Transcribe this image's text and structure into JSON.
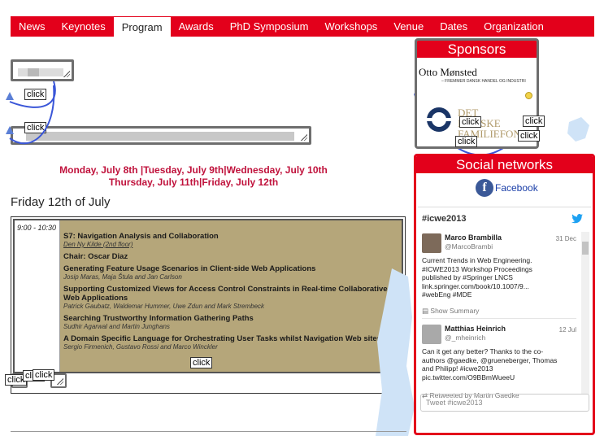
{
  "nav": {
    "items": [
      "News",
      "Keynotes",
      "Program",
      "Awards",
      "PhD Symposium",
      "Workshops",
      "Venue",
      "Dates",
      "Organization"
    ],
    "active": "Program"
  },
  "overlay": {
    "click_label": "click"
  },
  "days": {
    "line1": "Monday, July 8th |Tuesday, July 9th|Wednesday, July 10th",
    "line2": "Thursday, July 11th|Friday, July 12th"
  },
  "day_title": "Friday 12th of July",
  "schedule": {
    "time": "9:00 - 10:30",
    "sessions": [
      {
        "title": "S7: Navigation Analysis and Collaboration",
        "sub": "Den Ny Kilde (2nd floor)",
        "sub_link": true
      },
      {
        "title": "Chair: Oscar Diaz",
        "sub": ""
      },
      {
        "title": "Generating Feature Usage Scenarios in Client-side Web Applications",
        "sub": "Josip Maras, Maja Štula and Jan Carlson"
      },
      {
        "title": "Supporting Customized Views for Access Control Constraints in Real-time Collaborative Web Applications",
        "sub": "Patrick Gaubatz, Waldemar Hummer, Uwe Zdun and Mark Strembeck"
      },
      {
        "title": "Searching Trustworthy Information Gathering Paths",
        "sub": "Sudhir Agarwal and Martin Junghans"
      },
      {
        "title": "A Domain Specific Language for Orchestrating User Tasks whilst Navigation Web sites",
        "sub": "Sergio Firmenich, Gustavo Rossi and Marco Winckler"
      }
    ]
  },
  "sponsors": {
    "title": "Sponsors",
    "otto": "Otto Mønsted",
    "otto_sub": "– FREMMER DANSK HANDEL OG INDUSTRI",
    "det_line1": "DET",
    "det_line2": "DANSKE",
    "det_line3": "FAMILIEFOND"
  },
  "social": {
    "title": "Social networks",
    "facebook_label": "Facebook",
    "hashtag": "#icwe2013",
    "tweets": [
      {
        "name": "Marco Brambilla",
        "handle": "@MarcoBrambi",
        "date": "31 Dec",
        "body": "Current Trends in Web Engineering.\n#ICWE2013 Workshop Proceedings\npublished by #Springer LNCS\nlink.springer.com/book/10.1007/9...\n#webEng #MDE",
        "foot": "Show Summary"
      },
      {
        "name": "Matthias Heinrich",
        "handle": "@_mheinrich",
        "date": "12 Jul",
        "body": "Can it get any better?  Thanks to the co-\nauthors @gaedke, @grueneberger, Thomas\nand Philipp! #icwe2013\npic.twitter.com/O9BBmWueeU",
        "foot": "Retweeted by Martin Gaedke"
      }
    ],
    "tweet_placeholder": "Tweet #icwe2013"
  },
  "colors": {
    "brand_red": "#e3001b",
    "days_red": "#c0123c",
    "session_bg": "#b5a67a",
    "facebook_blue": "#3b5998",
    "twitter_blue": "#1da1f2"
  }
}
